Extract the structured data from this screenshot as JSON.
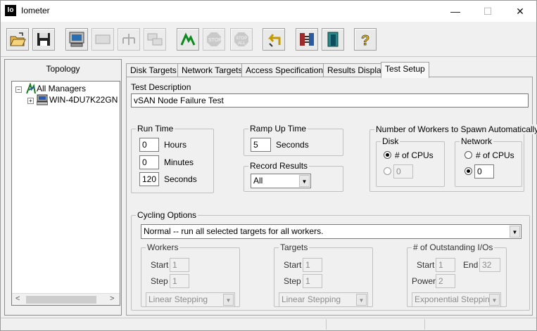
{
  "window": {
    "title": "Iometer",
    "app_icon": "Io"
  },
  "controls": {
    "minimize": "—",
    "maximize": "☐",
    "close": "✕"
  },
  "toolbar": {
    "buttons": [
      "open-icon",
      "save-icon",
      "start-display-icon",
      "new-worker-icon",
      "new-network-worker-icon",
      "copy-worker-icon",
      "start-icon",
      "stop-icon",
      "stop-all-icon",
      "reset-workers-icon",
      "disconnect-icon",
      "exit-icon",
      "help-icon"
    ]
  },
  "topology": {
    "title": "Topology",
    "root": "All Managers",
    "manager": "WIN-4DU7K22GN"
  },
  "tabs": [
    {
      "label": "Disk Targets"
    },
    {
      "label": "Network Targets"
    },
    {
      "label": "Access Specifications"
    },
    {
      "label": "Results Display"
    },
    {
      "label": "Test Setup"
    }
  ],
  "setup": {
    "desc_label": "Test Description",
    "desc_value": "vSAN Node Failure Test",
    "run_time": {
      "title": "Run Time",
      "hours_value": "0",
      "hours_label": "Hours",
      "minutes_value": "0",
      "minutes_label": "Minutes",
      "seconds_value": "120",
      "seconds_label": "Seconds"
    },
    "ramp_up": {
      "title": "Ramp Up Time",
      "value": "5",
      "unit": "Seconds"
    },
    "record": {
      "title": "Record Results",
      "value": "All"
    },
    "workers": {
      "title": "Number of Workers to Spawn Automatically",
      "disk_title": "Disk",
      "disk_opt1": "# of CPUs",
      "disk_value": "0",
      "net_title": "Network",
      "net_opt1": "# of CPUs",
      "net_value": "0"
    },
    "cycling": {
      "title": "Cycling Options",
      "mode": "Normal -- run all selected targets for all workers.",
      "workers_title": "Workers",
      "targets_title": "Targets",
      "outstanding_title": "# of Outstanding I/Os",
      "start_label": "Start",
      "step_label": "Step",
      "end_label": "End",
      "power_label": "Power",
      "w_start": "1",
      "w_step": "1",
      "w_mode": "Linear Stepping",
      "t_start": "1",
      "t_step": "1",
      "t_mode": "Linear Stepping",
      "o_start": "1",
      "o_end": "32",
      "o_power": "2",
      "o_mode": "Exponential Stepping"
    }
  }
}
